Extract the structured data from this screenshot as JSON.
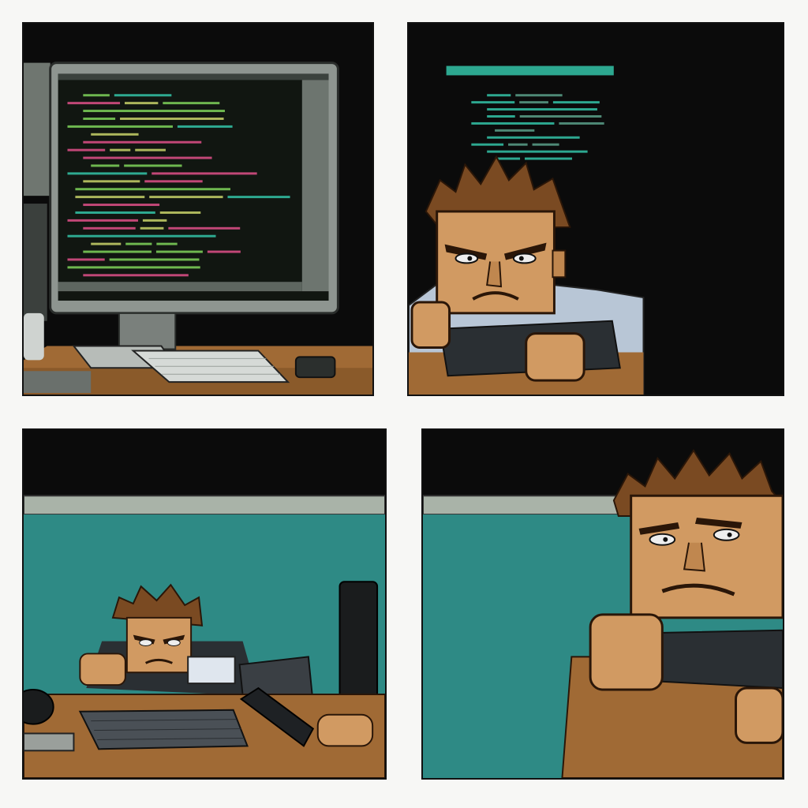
{
  "comic": {
    "panel_count": 4,
    "layout": "2x2 grid",
    "colors": {
      "page_background": "#f7f7f5",
      "panel_border": "#111111",
      "night_background": "#0b0b0b",
      "cubicle_wall": "#2e8a85",
      "cubicle_trim": "#a9b3a8",
      "desk": "#a06a35",
      "skin": "#d19a62",
      "hair": "#7a4a22",
      "shirt": "#b8c6d6",
      "code_green": "#7fd35a",
      "code_pink": "#e0508a",
      "code_teal": "#34c4a8"
    },
    "panels": [
      {
        "id": "panel-1",
        "scene": "monitor-with-code"
      },
      {
        "id": "panel-2",
        "scene": "angry-programmer-close"
      },
      {
        "id": "panel-3",
        "scene": "programmer-at-desk-wide"
      },
      {
        "id": "panel-4",
        "scene": "worried-programmer-close"
      }
    ]
  }
}
